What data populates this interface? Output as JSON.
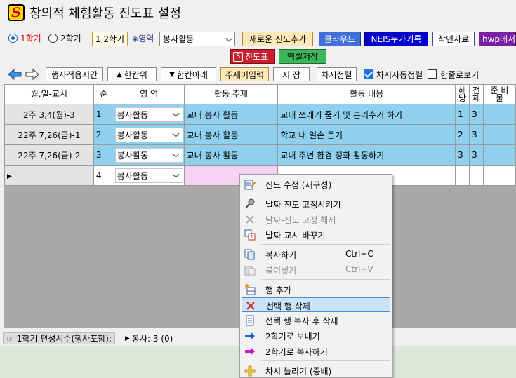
{
  "window": {
    "title": "창의적 체험활동 진도표 설정"
  },
  "toolbar1": {
    "semester1": "1학기",
    "semester2": "2학기",
    "semester12_button": "1,2학기",
    "area_label": "◈영역",
    "area_select": "봉사활동",
    "new_progress_button": "새로운 진도추가",
    "cloud_button": "클라우드",
    "neis_button": "NEIS누가기록",
    "prev_year_button": "작년자료",
    "hwp_button": "hwp에서"
  },
  "toolbar2": {
    "progress_button": "진도표",
    "excel_button": "엑셀저장"
  },
  "toolbar3": {
    "event_time_button": "행사적용시간",
    "up_button": "한칸위",
    "down_button": "한칸아래",
    "topic_input_button": "주제어입력",
    "save_button": "저 장",
    "sort_button": "차시정렬",
    "auto_sort_label": "차시자동정렬",
    "auto_sort_checked": true,
    "hanjul_label": "한줄로보기",
    "hanjul_checked": false
  },
  "grid": {
    "headers": {
      "date": "월,일-교시",
      "order": "순",
      "area": "영 역",
      "topic": "활동 주제",
      "content": "활동 내용",
      "applies_1": "해",
      "applies_2": "당",
      "total_1": "전",
      "total_2": "체",
      "prep_1": "준 비",
      "prep_2": "물"
    },
    "rows": [
      {
        "date": "2주 3,4(월)-3",
        "order": "1",
        "area": "봉사활동",
        "topic": "교내 봉사 활동",
        "content": "교내 쓰레기 줍기 및 분리수거 하기",
        "applies": "1",
        "total": "3",
        "prep": ""
      },
      {
        "date": "22주 7,26(금)-1",
        "order": "2",
        "area": "봉사활동",
        "topic": "교내 봉사 활동",
        "content": "학교 내 일손 돕기",
        "applies": "2",
        "total": "3",
        "prep": ""
      },
      {
        "date": "22주 7,26(금)-2",
        "order": "3",
        "area": "봉사활동",
        "topic": "교내 봉사 활동",
        "content": "교내 주변 환경 정화 활동하기",
        "applies": "3",
        "total": "3",
        "prep": ""
      }
    ],
    "new_row": {
      "order": "4",
      "area": "봉사활동"
    }
  },
  "context_menu": {
    "items": [
      {
        "label": "진도 수정 (재구성)",
        "shortcut": "",
        "icon": "edit-icon",
        "disabled": false
      },
      {
        "label": "날짜-진도 고정시키기",
        "shortcut": "",
        "icon": "pin-icon",
        "disabled": false
      },
      {
        "label": "날짜-진도 고정 해제",
        "shortcut": "",
        "icon": "unpin-icon",
        "disabled": true
      },
      {
        "label": "날짜-교시 바꾸기",
        "shortcut": "",
        "icon": "swap-icon",
        "disabled": false
      },
      {
        "label": "복사하기",
        "shortcut": "Ctrl+C",
        "icon": "copy-icon",
        "disabled": false
      },
      {
        "label": "붙여넣기",
        "shortcut": "Ctrl+V",
        "icon": "paste-icon",
        "disabled": true
      },
      {
        "label": "행 추가",
        "shortcut": "",
        "icon": "add-row-icon",
        "disabled": false
      },
      {
        "label": "선택 행 삭제",
        "shortcut": "",
        "icon": "delete-icon",
        "disabled": false
      },
      {
        "label": "선택 행 복사 후 삭제",
        "shortcut": "",
        "icon": "copy-delete-icon",
        "disabled": false
      },
      {
        "label": "2학기로 보내기",
        "shortcut": "",
        "icon": "send-arrow-icon",
        "disabled": false
      },
      {
        "label": "2학기로 복사하기",
        "shortcut": "",
        "icon": "copy-arrow-icon",
        "disabled": false
      },
      {
        "label": "차시 늘리기 (증배)",
        "shortcut": "",
        "icon": "plus-icon",
        "disabled": false
      }
    ]
  },
  "status": {
    "semester_count": "1학기 편성시수(행사포함):",
    "service_count": "봉사: 3 (0)"
  },
  "colors": {
    "selected_row": "#8fd0ee",
    "new_row_cell": "#f6d2f2",
    "cloud_button": "#3f6fd8",
    "neis_button": "#0000cc",
    "hwp_button": "#7a1fa2",
    "progress_button": "#cc1f2e",
    "excel_button": "#3cb85a"
  }
}
